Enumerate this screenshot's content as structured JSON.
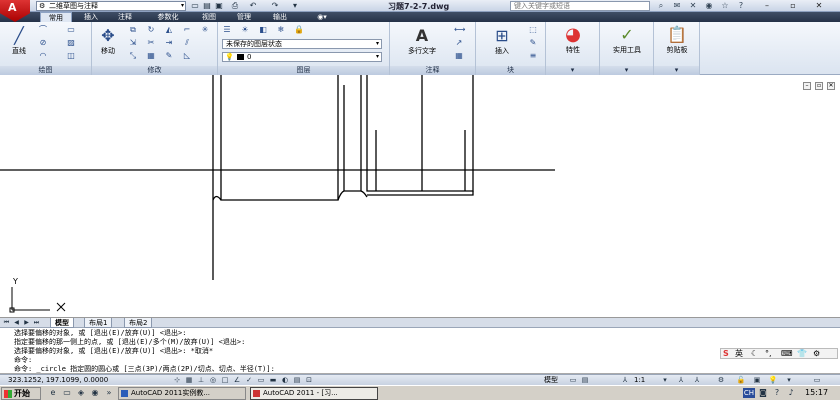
{
  "titlebar": {
    "workspace": "二维草图与注释",
    "doc_title": "习题7-2-7.dwg",
    "search_placeholder": "键入关键字或短语",
    "icons": [
      "app-logo-icon",
      "gear-icon",
      "new-icon",
      "open-icon",
      "save-icon",
      "print-icon",
      "undo-icon",
      "redo-icon",
      "search-icon",
      "star-icon",
      "help-icon"
    ]
  },
  "menubar": {
    "items": [
      "常用",
      "插入",
      "注释",
      "参数化",
      "视图",
      "管理",
      "输出"
    ]
  },
  "ribbon": {
    "draw": {
      "label": "绘图",
      "line_label": "直线"
    },
    "modify": {
      "label": "修改",
      "move_label": "移动"
    },
    "layers": {
      "label": "图层",
      "layer_state": "未保存的图层状态",
      "current_layer": "0"
    },
    "annotation": {
      "label": "注释",
      "mtext_label": "多行文字"
    },
    "block": {
      "label": "块",
      "insert_label": "插入"
    },
    "properties": {
      "label": "特性"
    },
    "utilities": {
      "label": "实用工具"
    },
    "clipboard": {
      "label": "剪贴板"
    }
  },
  "ucs": {
    "x_label": "X",
    "y_label": "Y"
  },
  "layout_tabs": [
    "模型",
    "布局1",
    "布局2"
  ],
  "command": {
    "lines": [
      "选择要偏移的对象, 或 [退出(E)/放弃(U)] <退出>:",
      "指定要偏移的那一侧上的点, 或 [退出(E)/多个(M)/放弃(U)] <退出>:",
      "选择要偏移的对象, 或 [退出(E)/放弃(U)] <退出>: *取消*",
      "命令:",
      "命令: _circle 指定圆的圆心或 [三点(3P)/两点(2P)/切点、切点、半径(T)]:"
    ]
  },
  "ime": {
    "label": "英"
  },
  "statusbar": {
    "coords": "323.1252, 197.1099, 0.0000",
    "model": "模型",
    "scale": "1:1"
  },
  "taskbar": {
    "start": "开始",
    "tasks": [
      "AutoCAD 2011实例教...",
      "AutoCAD 2011 - [习..."
    ],
    "lang": "CH",
    "clock": "15:17"
  },
  "colors": {
    "menubar": "#2f3c53",
    "accent": "#c62828"
  }
}
